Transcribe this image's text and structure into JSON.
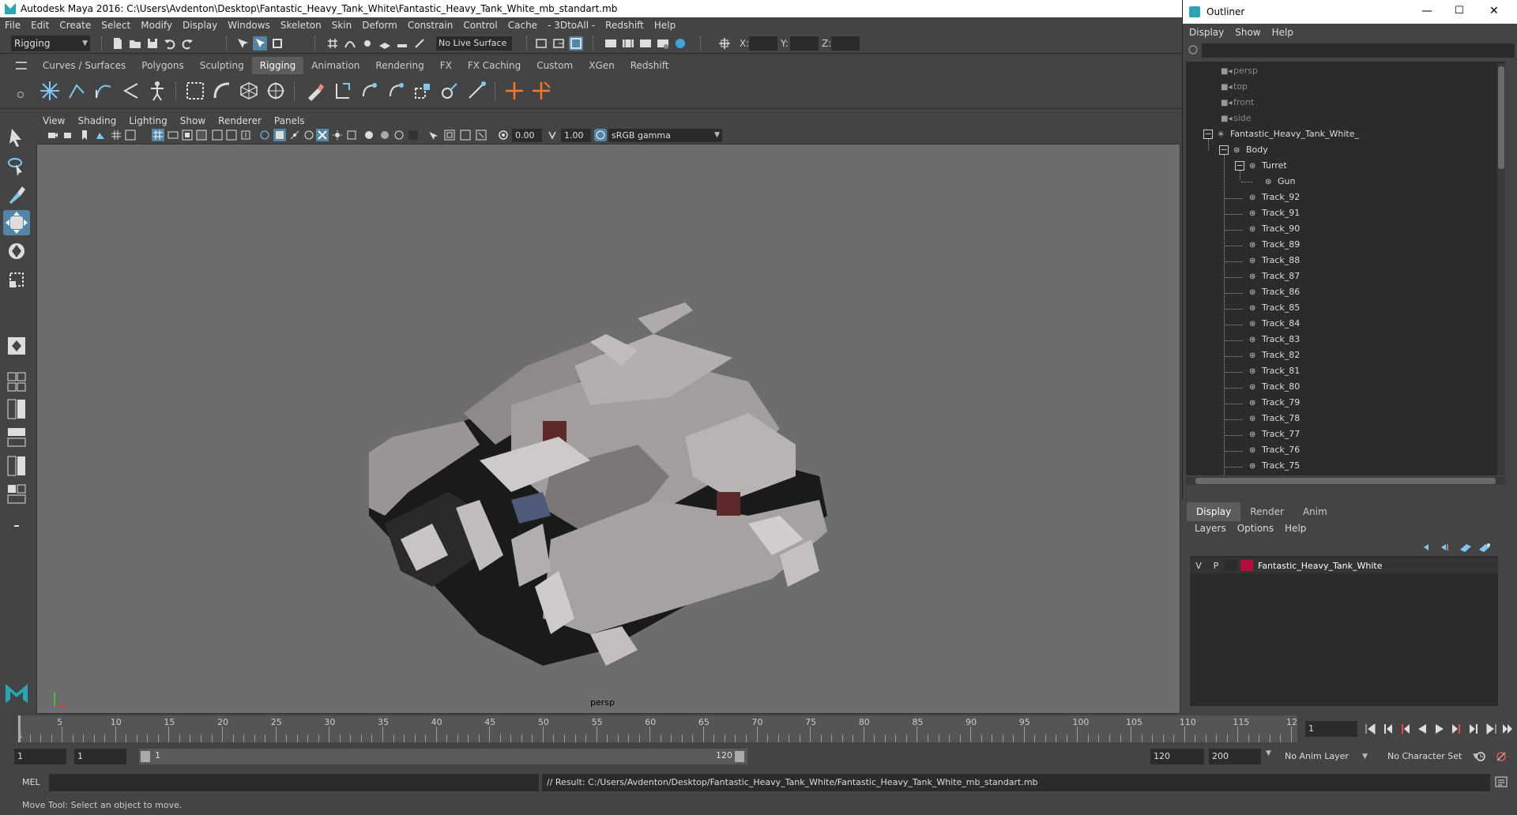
{
  "window": {
    "title": "Autodesk Maya 2016: C:\\Users\\Avdenton\\Desktop\\Fantastic_Heavy_Tank_White\\Fantastic_Heavy_Tank_White_mb_standart.mb"
  },
  "menubar": [
    "File",
    "Edit",
    "Create",
    "Select",
    "Modify",
    "Display",
    "Windows",
    "Skeleton",
    "Skin",
    "Deform",
    "Constrain",
    "Control",
    "Cache",
    "- 3DtoAll -",
    "Redshift",
    "Help"
  ],
  "statusline": {
    "mode": "Rigging",
    "live_surface": "No Live Surface",
    "x_label": "X:",
    "y_label": "Y:",
    "z_label": "Z:"
  },
  "shelf_tabs": [
    "Curves / Surfaces",
    "Polygons",
    "Sculpting",
    "Rigging",
    "Animation",
    "Rendering",
    "FX",
    "FX Caching",
    "Custom",
    "XGen",
    "Redshift"
  ],
  "shelf_active": "Rigging",
  "panel_menu": [
    "View",
    "Shading",
    "Lighting",
    "Show",
    "Renderer",
    "Panels"
  ],
  "panel_toolbar": {
    "exposure": "0.00",
    "gamma": "1.00",
    "color_space": "sRGB gamma"
  },
  "viewport": {
    "camera": "persp"
  },
  "timeline": {
    "ticks": [
      1,
      5,
      10,
      15,
      20,
      25,
      30,
      35,
      40,
      45,
      50,
      55,
      60,
      65,
      70,
      75,
      80,
      85,
      90,
      95,
      100,
      105,
      110,
      115,
      120
    ],
    "current_frame": "1"
  },
  "range": {
    "start": "1",
    "playback_start": "1",
    "slider_start": "1",
    "slider_end": "120",
    "playback_end": "120",
    "end": "200",
    "anim_layer": "No Anim Layer",
    "char_set": "No Character Set"
  },
  "cmdline": {
    "label": "MEL",
    "result": "// Result: C:/Users/Avdenton/Desktop/Fantastic_Heavy_Tank_White/Fantastic_Heavy_Tank_White_mb_standart.mb"
  },
  "helpline": "Move Tool: Select an object to move.",
  "outliner": {
    "title": "Outliner",
    "menu": [
      "Display",
      "Show",
      "Help"
    ],
    "cameras": [
      "persp",
      "top",
      "front",
      "side"
    ],
    "root": "Fantastic_Heavy_Tank_White_",
    "body": "Body",
    "turret": "Turret",
    "gun": "Gun",
    "tracks": [
      "Track_92",
      "Track_91",
      "Track_90",
      "Track_89",
      "Track_88",
      "Track_87",
      "Track_86",
      "Track_85",
      "Track_84",
      "Track_83",
      "Track_82",
      "Track_81",
      "Track_80",
      "Track_79",
      "Track_78",
      "Track_77",
      "Track_76",
      "Track_75"
    ]
  },
  "layer_editor": {
    "tabs": [
      "Display",
      "Render",
      "Anim"
    ],
    "active_tab": "Display",
    "menu": [
      "Layers",
      "Options",
      "Help"
    ],
    "layer": {
      "v": "V",
      "p": "P",
      "name": "Fantastic_Heavy_Tank_White",
      "color": "#b0103a"
    }
  },
  "colors": {
    "accent": "#5285a6",
    "panel": "#444444",
    "field": "#2b2b2b",
    "viewport": "#6d6d6d"
  }
}
